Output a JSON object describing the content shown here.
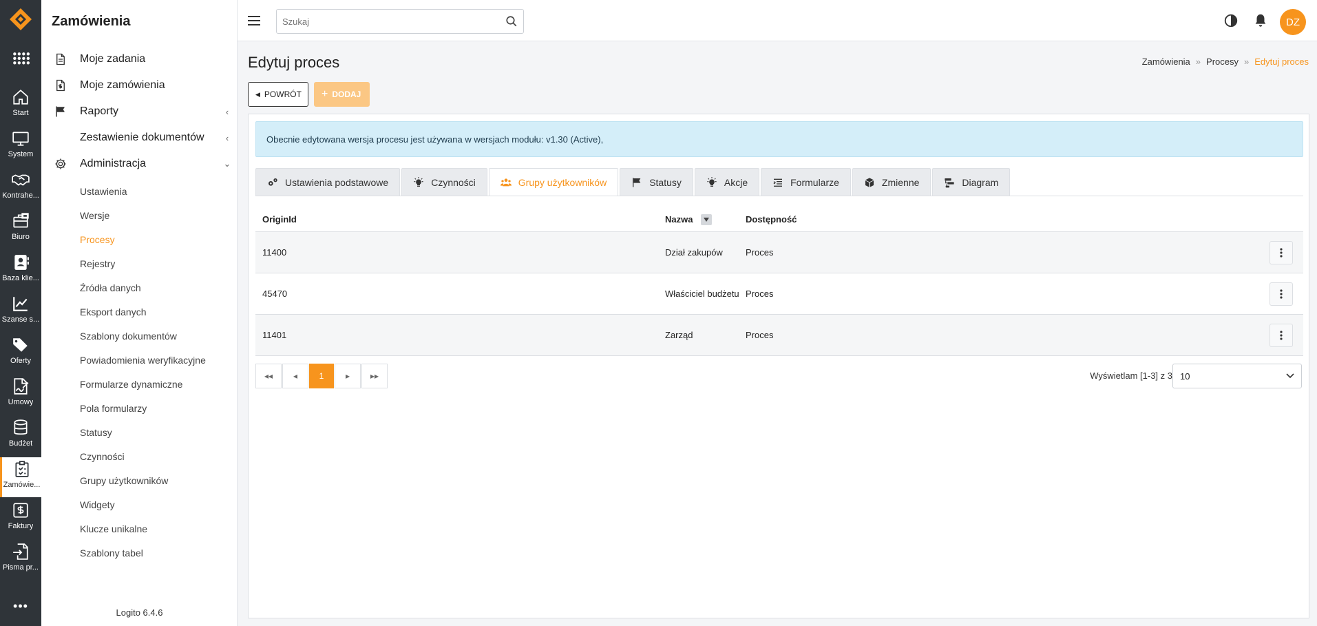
{
  "rail": {
    "items": [
      {
        "label": "Start",
        "icon": "home-icon"
      },
      {
        "label": "System",
        "icon": "monitor-icon"
      },
      {
        "label": "Kontrahe...",
        "icon": "handshake-icon"
      },
      {
        "label": "Biuro",
        "icon": "briefcase-icon"
      },
      {
        "label": "Baza klie...",
        "icon": "contact-book-icon"
      },
      {
        "label": "Szanse s...",
        "icon": "chart-line-icon"
      },
      {
        "label": "Oferty",
        "icon": "tags-icon"
      },
      {
        "label": "Umowy",
        "icon": "contract-icon"
      },
      {
        "label": "Budżet",
        "icon": "database-icon"
      },
      {
        "label": "Zamówie...",
        "icon": "clipboard-icon"
      },
      {
        "label": "Faktury",
        "icon": "invoice-icon"
      },
      {
        "label": "Pisma pr...",
        "icon": "file-import-icon"
      }
    ],
    "more": "•••"
  },
  "sidebar": {
    "title": "Zamówienia",
    "main_items": [
      {
        "label": "Moje zadania"
      },
      {
        "label": "Moje zamówienia"
      },
      {
        "label": "Raporty"
      },
      {
        "label": "Zestawienie dokumentów"
      },
      {
        "label": "Administracja"
      }
    ],
    "sub_items": [
      "Ustawienia",
      "Wersje",
      "Procesy",
      "Rejestry",
      "Źródła danych",
      "Eksport danych",
      "Szablony dokumentów",
      "Powiadomienia weryfikacyjne",
      "Formularze dynamiczne",
      "Pola formularzy",
      "Statusy",
      "Czynności",
      "Grupy użytkowników",
      "Widgety",
      "Klucze unikalne",
      "Szablony tabel"
    ],
    "version": "Logito 6.4.6"
  },
  "topbar": {
    "search_placeholder": "Szukaj",
    "avatar": "DZ"
  },
  "page": {
    "title": "Edytuj proces",
    "breadcrumb": [
      "Zamówienia",
      "Procesy",
      "Edytuj proces"
    ],
    "back_label": "POWRÓT",
    "add_label": "DODAJ",
    "alert": "Obecnie edytowana wersja procesu jest używana w wersjach modułu: v1.30 (Active),"
  },
  "tabs": [
    {
      "label": "Ustawienia podstawowe",
      "icon": "cogs-icon"
    },
    {
      "label": "Czynności",
      "icon": "bulb-icon"
    },
    {
      "label": "Grupy użytkowników",
      "icon": "users-icon"
    },
    {
      "label": "Statusy",
      "icon": "flag-icon"
    },
    {
      "label": "Akcje",
      "icon": "bulb-icon"
    },
    {
      "label": "Formularze",
      "icon": "list-icon"
    },
    {
      "label": "Zmienne",
      "icon": "cube-icon"
    },
    {
      "label": "Diagram",
      "icon": "diagram-icon"
    }
  ],
  "table": {
    "headers": {
      "origin": "OriginId",
      "name": "Nazwa",
      "access": "Dostępność"
    },
    "rows": [
      {
        "origin": "11400",
        "name": "Dział zakupów",
        "access": "Proces"
      },
      {
        "origin": "45470",
        "name": "Właściciel budżetu",
        "access": "Proces"
      },
      {
        "origin": "11401",
        "name": "Zarząd",
        "access": "Proces"
      }
    ]
  },
  "pagination": {
    "current": "1",
    "info": "Wyświetlam [1-3] z 3",
    "page_size": "10"
  },
  "colors": {
    "accent": "#f7941d",
    "rail": "#2f3439",
    "alert": "#d4eef9"
  }
}
